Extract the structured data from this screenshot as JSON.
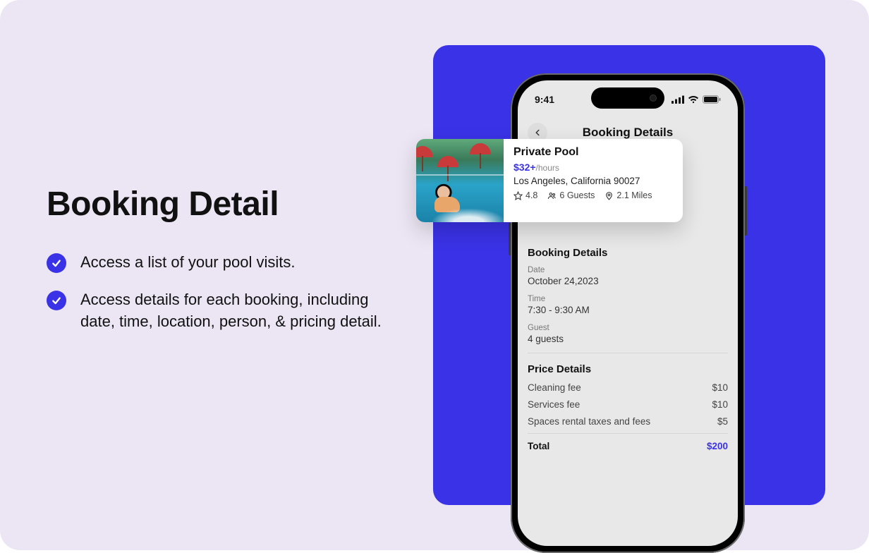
{
  "left": {
    "heading": "Booking Detail",
    "bullets": [
      "Access a list of your pool visits.",
      "Access details for each booking, including date, time, location, person, & pricing detail."
    ]
  },
  "phone": {
    "status_time": "9:41",
    "app_title": "Booking Details",
    "listing": {
      "title": "Private Pool",
      "price": "$32+",
      "price_unit": "/hours",
      "location": "Los Angeles, California 90027",
      "rating": "4.8",
      "guests": "6 Guests",
      "distance": "2.1 Miles"
    },
    "booking_details": {
      "section_title": "Booking Details",
      "rows": [
        {
          "label": "Date",
          "value": "October 24,2023"
        },
        {
          "label": "Time",
          "value": "7:30 - 9:30 AM"
        },
        {
          "label": "Guest",
          "value": "4 guests"
        }
      ]
    },
    "price_details": {
      "section_title": "Price Details",
      "lines": [
        {
          "label": "Cleaning fee",
          "value": "$10"
        },
        {
          "label": "Services fee",
          "value": "$10"
        },
        {
          "label": "Spaces rental taxes and fees",
          "value": "$5"
        }
      ],
      "total_label": "Total",
      "total_value": "$200"
    }
  }
}
